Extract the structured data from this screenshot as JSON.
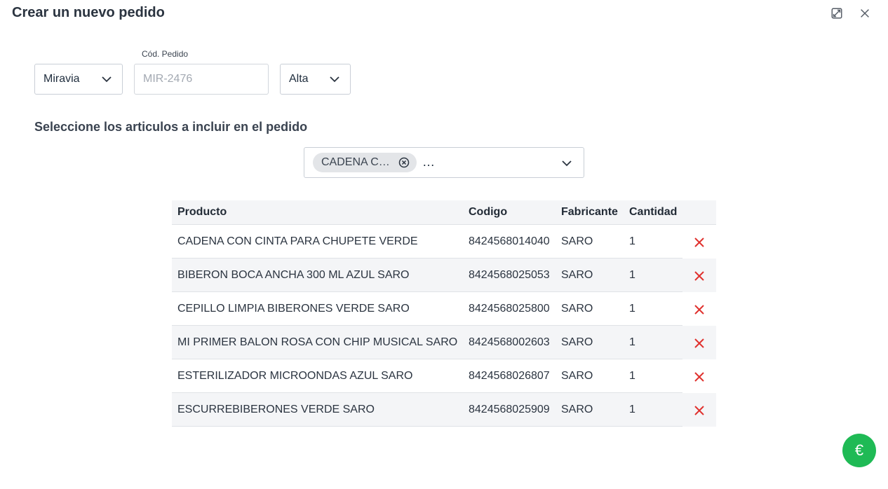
{
  "modal": {
    "title": "Crear un nuevo pedido"
  },
  "header_icons": {
    "expand": "expand-icon",
    "close": "close-icon"
  },
  "form": {
    "marketplace_value": "Miravia",
    "order_code_label": "Cód. Pedido",
    "order_code_placeholder": "MIR-2476",
    "order_code_value": "",
    "priority_value": "Alta"
  },
  "items_section": {
    "title": "Seleccione los articulos a incluir en el pedido",
    "selected_chip": "CADENA C…",
    "more_indicator": "…"
  },
  "table": {
    "headers": {
      "product": "Producto",
      "code": "Codigo",
      "manufacturer": "Fabricante",
      "quantity": "Cantidad"
    },
    "rows": [
      {
        "product": "CADENA CON CINTA PARA CHUPETE VERDE",
        "code": "8424568014040",
        "manufacturer": "SARO",
        "quantity": "1"
      },
      {
        "product": "BIBERON BOCA ANCHA 300 ML AZUL SARO",
        "code": "8424568025053",
        "manufacturer": "SARO",
        "quantity": "1"
      },
      {
        "product": "CEPILLO LIMPIA BIBERONES VERDE SARO",
        "code": "8424568025800",
        "manufacturer": "SARO",
        "quantity": "1"
      },
      {
        "product": "MI PRIMER BALON ROSA CON CHIP MUSICAL SARO",
        "code": "8424568002603",
        "manufacturer": "SARO",
        "quantity": "1"
      },
      {
        "product": "ESTERILIZADOR MICROONDAS AZUL SARO",
        "code": "8424568026807",
        "manufacturer": "SARO",
        "quantity": "1"
      },
      {
        "product": "ESCURREBIBERONES VERDE SARO",
        "code": "8424568025909",
        "manufacturer": "SARO",
        "quantity": "1"
      }
    ],
    "delete_icon": "close-red-icon"
  },
  "fab": {
    "symbol": "€",
    "color": "#1fba55"
  },
  "colors": {
    "delete": "#e0322e",
    "row_alt": "#f4f5f7"
  }
}
